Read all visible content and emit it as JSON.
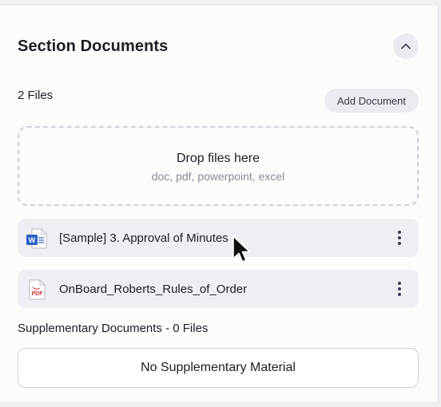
{
  "section": {
    "title": "Section Documents",
    "file_count": "2 Files",
    "add_button_label": "Add Document",
    "collapse_icon": "chevron-up-icon"
  },
  "dropzone": {
    "title": "Drop files here",
    "subtitle": "doc, pdf, powerpoint, excel"
  },
  "files": [
    {
      "name": "[Sample] 3. Approval of Minutes",
      "type": "word",
      "icon": "word-file-icon",
      "icon_color": "#2b5fc4"
    },
    {
      "name": "OnBoard_Roberts_Rules_of_Order",
      "type": "pdf",
      "icon": "pdf-file-icon",
      "icon_color": "#d0312d",
      "icon_text": "PDF"
    }
  ],
  "supplementary": {
    "title": "Supplementary Documents - 0 Files",
    "empty_text": "No Supplementary Material"
  },
  "colors": {
    "accent_bg": "#ebeaf1",
    "row_bg": "#efeef4",
    "text": "#1d1d25",
    "muted": "#8c8b97"
  }
}
